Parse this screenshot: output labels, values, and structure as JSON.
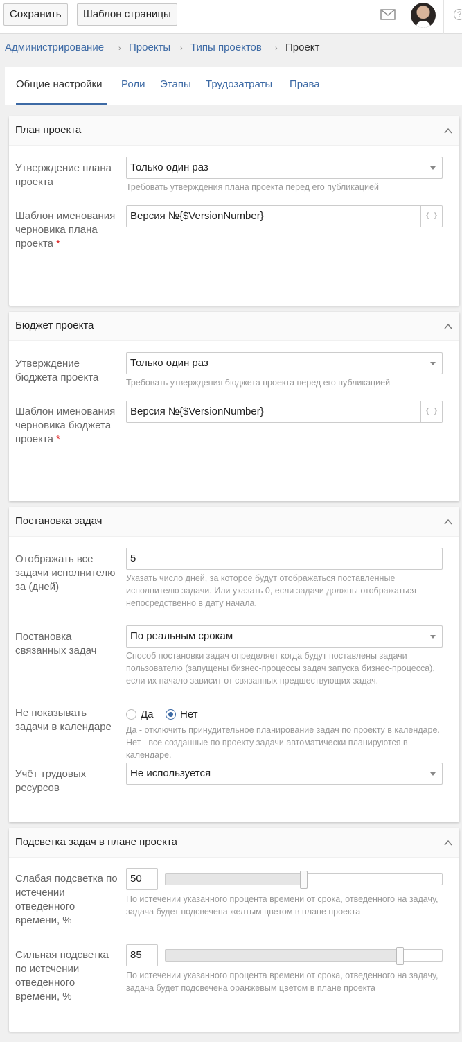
{
  "toolbar": {
    "save_label": "Сохранить",
    "template_label": "Шаблон страницы",
    "help_glyph": "?"
  },
  "breadcrumb": {
    "items": [
      "Администрирование",
      "Проекты",
      "Типы проектов"
    ],
    "current": "Проект",
    "separator": "›"
  },
  "tabs": [
    {
      "label": "Общие настройки",
      "active": true
    },
    {
      "label": "Роли"
    },
    {
      "label": "Этапы"
    },
    {
      "label": "Трудозатраты"
    },
    {
      "label": "Права"
    }
  ],
  "plan": {
    "title": "План проекта",
    "approval_label": "Утверждение плана проекта",
    "approval_value": "Только один раз",
    "approval_hint": "Требовать утверждения плана проекта перед его публикацией",
    "naming_label": "Шаблон именования черновика плана проекта",
    "naming_value": "Версия №{$VersionNumber}",
    "required_mark": "*",
    "braces": "{ }"
  },
  "budget": {
    "title": "Бюджет проекта",
    "approval_label": "Утверждение бюджета проекта",
    "approval_value": "Только один раз",
    "approval_hint": "Требовать утверждения бюджета проекта перед его публикацией",
    "naming_label": "Шаблон именования черновика бюджета проекта",
    "naming_value": "Версия №{$VersionNumber}",
    "required_mark": "*",
    "braces": "{ }"
  },
  "tasks": {
    "title": "Постановка задач",
    "days_label": "Отображать все задачи исполнителю за (дней)",
    "days_value": "5",
    "days_hint": "Указать число дней, за которое будут отображаться поставленные исполнителю задачи. Или указать 0, если задачи должны отображаться непосредственно в дату начала.",
    "linked_label": "Постановка связанных задач",
    "linked_value": "По реальным срокам",
    "linked_hint": "Способ постановки задач определяет когда будут поставлены задачи пользователю (запущены бизнес-процессы задач запуска бизнес-процесса), если их начало зависит от связанных предшествующих задач.",
    "calendar_label": "Не показывать задачи в календаре",
    "radio_yes": "Да",
    "radio_no": "Нет",
    "calendar_selected": "Нет",
    "calendar_hint": "Да - отключить принудительное планирование задач по проекту в календаре. Нет - все созданные по проекту задачи автоматически планируются в календаре.",
    "resources_label": "Учёт трудовых ресурсов",
    "resources_value": "Не используется"
  },
  "highlight": {
    "title": "Подсветка задач в плане проекта",
    "weak_label": "Слабая подсветка по истечении отведенного времени, %",
    "weak_value": "50",
    "weak_percent": 50,
    "weak_hint": "По истечении указанного процента времени от срока, отведенного на задачу, задача будет подсвечена желтым цветом в плане проекта",
    "strong_label": "Сильная подсветка по истечении отведенного времени, %",
    "strong_value": "85",
    "strong_percent": 85,
    "strong_hint": "По истечении указанного процента времени от срока, отведенного на задачу, задача будет подсвечена оранжевым цветом в плане проекта"
  },
  "colors": {
    "accent": "#3d6aa5",
    "required": "#dd2222",
    "hint": "#999999"
  }
}
